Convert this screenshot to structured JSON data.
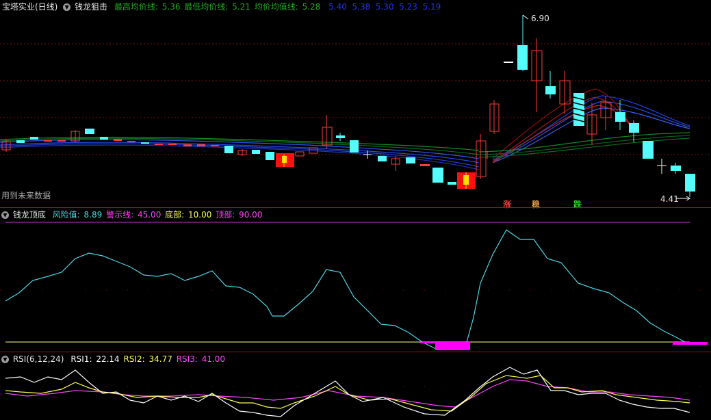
{
  "main": {
    "stock_name": "宝塔实业(日线)",
    "indicator_name": "钱龙狙击",
    "line1_label": "最高均价线:",
    "line1_value": "5.36",
    "line2_label": "最低均价线:",
    "line2_value": "5.21",
    "line3_label": "均价均值线:",
    "line3_value": "5.28",
    "extra_values": "5.40  5.38  5.30  5.23  5.19",
    "high_price": "6.90",
    "low_price": "4.41",
    "future_note": "用到未来数据",
    "signal_rise": "涨",
    "signal_steady": "稳",
    "signal_fall": "跌"
  },
  "sub1": {
    "name": "钱龙顶底",
    "risk_label": "风险值:",
    "risk_value": "8.89",
    "warn_label": "警示线:",
    "warn_value": "45.00",
    "bottom_label": "底部:",
    "bottom_value": "10.00",
    "top_label": "顶部:",
    "top_value": "90.00"
  },
  "sub2": {
    "name": "RSI(6,12,24)",
    "rsi1_label": "RSI1:",
    "rsi1_value": "22.14",
    "rsi2_label": "RSI2:",
    "rsi2_value": "34.77",
    "rsi3_label": "RSI3:",
    "rsi3_value": "41.00"
  },
  "colors": {
    "up": "#ff3b3b",
    "down": "#54fcfc",
    "risk_line": "#4fd6e6",
    "rsi1": "#ffffff",
    "rsi2": "#ffff55",
    "rsi3": "#ff44ff",
    "frame": "#b01010"
  },
  "icons": [
    "settings-circle-icon",
    "settings-circle-icon",
    "settings-circle-icon",
    "settings-circle-icon"
  ]
}
